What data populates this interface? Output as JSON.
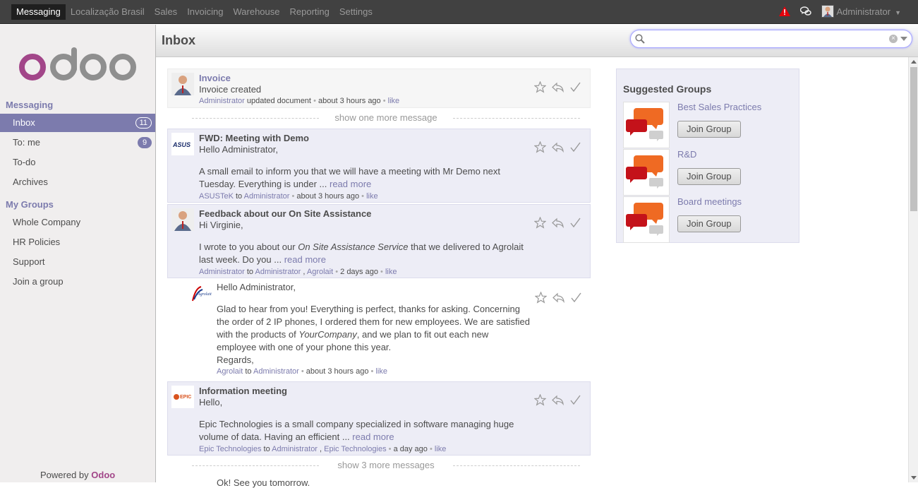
{
  "topbar": {
    "menu": [
      "Messaging",
      "Localização Brasil",
      "Sales",
      "Invoicing",
      "Warehouse",
      "Reporting",
      "Settings"
    ],
    "user": "Administrator"
  },
  "sidebar": {
    "messaging_title": "Messaging",
    "items": [
      {
        "label": "Inbox",
        "count": "11"
      },
      {
        "label": "To: me",
        "count": "9"
      },
      {
        "label": "To-do"
      },
      {
        "label": "Archives"
      }
    ],
    "groups_title": "My Groups",
    "groups": [
      "Whole Company",
      "HR Policies",
      "Support",
      "Join a group"
    ],
    "powered_prefix": "Powered by",
    "powered_brand": "Odoo"
  },
  "header": {
    "title": "Inbox",
    "search_value": ""
  },
  "messages": {
    "m1": {
      "subject": "Invoice",
      "body": "Invoice created",
      "author": "Administrator",
      "action": "updated document",
      "time": "about 3 hours ago",
      "like": "like"
    },
    "sep1": "show one more message",
    "m2": {
      "subject": "FWD: Meeting with Demo",
      "greeting": "Hello Administrator,",
      "body": "A small email to inform you that we will have a meeting with Mr Demo next Tuesday. Everything is under ...",
      "read_more": "read more",
      "author": "ASUSTeK",
      "to": "to",
      "recipient": "Administrator",
      "time": "about 3 hours ago",
      "like": "like"
    },
    "m3": {
      "subject": "Feedback about our On Site Assistance",
      "greeting": "Hi Virginie,",
      "body_pre": "I wrote to you about our",
      "body_em": "On Site Assistance Service",
      "body_post": "that we delivered to Agrolait last week. Do you ...",
      "read_more": "read more",
      "author": "Administrator",
      "to": "to",
      "recipient": "Administrator",
      "recipient2": "Agrolait",
      "time": "2 days ago",
      "like": "like"
    },
    "m4": {
      "greeting": "Hello Administrator,",
      "body_pre": "Glad to hear from you! Everything is perfect, thanks for asking. Concerning the order of 2 IP phones, I ordered them for new employees. We are satisfied with the products of",
      "body_em": "YourCompany",
      "body_post": ", and we plan to fit out each new employee with one of your phone this year.",
      "regards": "Regards,",
      "author": "Agrolait",
      "to": "to",
      "recipient": "Administrator",
      "time": "about 3 hours ago",
      "like": "like"
    },
    "m5": {
      "subject": "Information meeting",
      "greeting": "Hello,",
      "body": "Epic Technologies is a small company specialized in software managing huge volume of data. Having an efficient ...",
      "read_more": "read more",
      "author": "Epic Technologies",
      "to": "to",
      "recipient": "Administrator",
      "recipient2": "Epic Technologies",
      "time": "a day ago",
      "like": "like"
    },
    "sep2": "show 3 more messages",
    "m6_partial": "Ok! See you tomorrow."
  },
  "suggested": {
    "title": "Suggested Groups",
    "groups": [
      {
        "name": "Best Sales Practices",
        "button": "Join Group"
      },
      {
        "name": "R&D",
        "button": "Join Group"
      },
      {
        "name": "Board meetings",
        "button": "Join Group"
      }
    ]
  },
  "colors": {
    "accent": "#7c7bad",
    "topbar": "#414141",
    "unread_bg": "#ededf6",
    "alert": "#e3000b"
  },
  "icons": [
    "warning-icon",
    "chat-icon",
    "search-icon",
    "star-icon",
    "reply-icon",
    "check-icon"
  ]
}
